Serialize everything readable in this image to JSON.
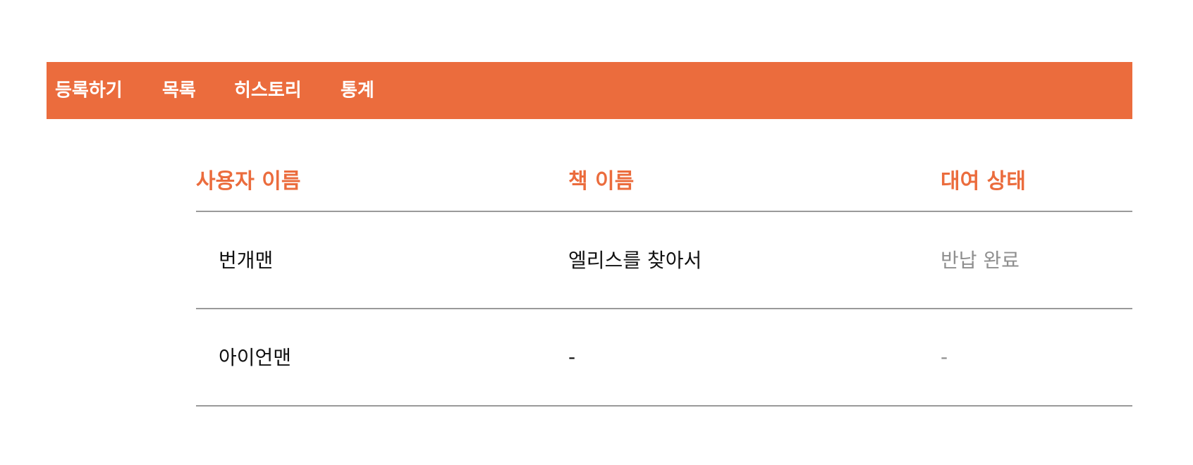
{
  "nav": {
    "items": [
      "등록하기",
      "목록",
      "히스토리",
      "통계"
    ]
  },
  "table": {
    "headers": {
      "user": "사용자 이름",
      "book": "책 이름",
      "status": "대여 상태"
    },
    "rows": [
      {
        "user": "번개맨",
        "book": "엘리스를 찾아서",
        "status": "반납 완료"
      },
      {
        "user": "아이언맨",
        "book": "-",
        "status": "-"
      }
    ]
  },
  "colors": {
    "accent": "#EB6C3D",
    "text": "#111111",
    "muted": "#8f8f8f",
    "divider": "#9a9a9a"
  }
}
